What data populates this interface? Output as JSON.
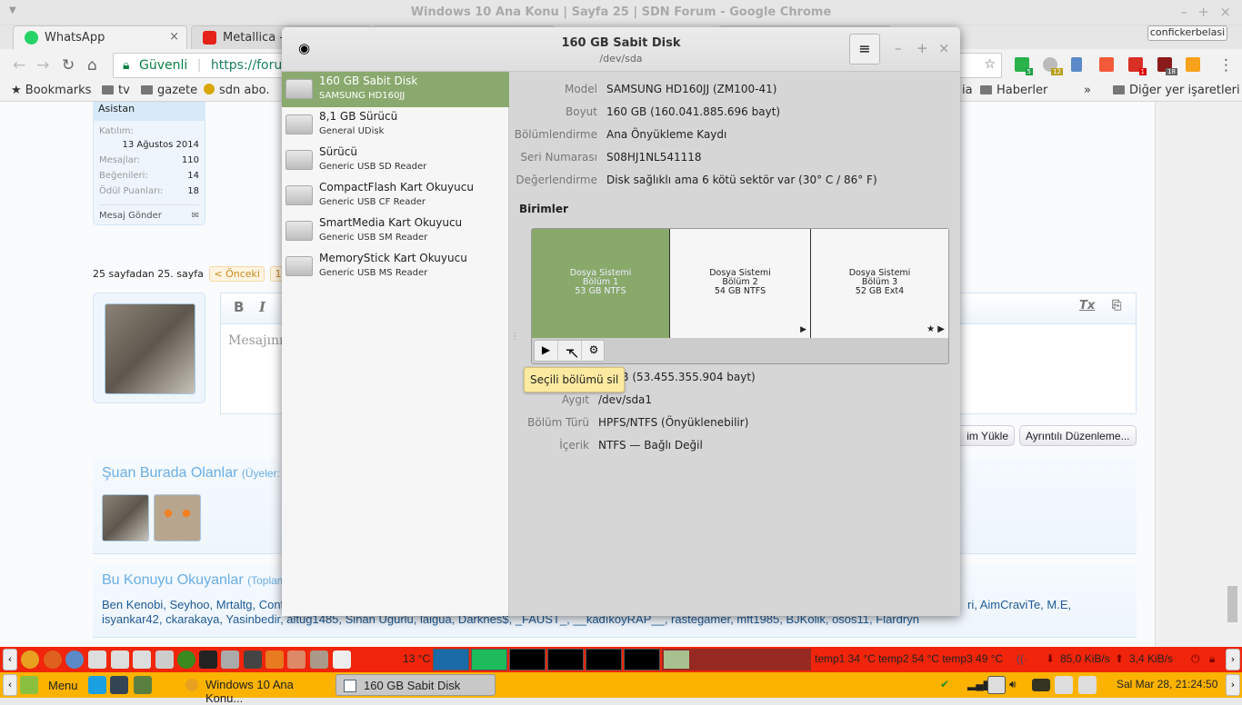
{
  "browser": {
    "window_title": "Windows 10 Ana Konu | Sayfa 25 | SDN Forum - Google Chrome",
    "tabs": [
      {
        "label": "WhatsApp",
        "close": "×"
      },
      {
        "label": "Metallica - Th"
      }
    ],
    "profile": "confickerbelasi",
    "security": "Güvenli",
    "url": "https://forum",
    "extension_badges": [
      "5",
      "12",
      "1",
      "18"
    ],
    "bookmarks": [
      "Bookmarks",
      "tv",
      "gazete",
      "sdn abo.",
      "ia",
      "Haberler",
      "»",
      "Diğer yer işaretleri"
    ]
  },
  "forum": {
    "user_title": "Asistan",
    "joined_label": "Katılım:",
    "joined": "13 Ağustos 2014",
    "stats": [
      {
        "label": "Mesajlar:",
        "value": "110"
      },
      {
        "label": "Beğenileri:",
        "value": "14"
      },
      {
        "label": "Ödül Puanları:",
        "value": "18"
      }
    ],
    "send_message": "Mesaj Gönder",
    "page_info": "25 sayfadan 25. sayfa",
    "prev": "< Önceki",
    "page1": "1",
    "arrow": "←",
    "editor": {
      "bold": "B",
      "italic": "I",
      "placeholder": "Mesajınız"
    },
    "buttons": {
      "upload": "im Yükle",
      "advanced": "Ayrıntılı Düzenleme..."
    },
    "here_title": "Şuan Burada Olanlar",
    "here_sub": "(Üyeler:",
    "readers_title": "Bu Konuyu Okuyanlar",
    "readers_sub": "(Toplam",
    "readers_line1": "Ben Kenobi, Seyhoo, Mrtaltg, Conf",
    "readers_line1_end": "ri, AimCraviTe, M.E,",
    "readers_line2": "isyankar42, ckarakaya, Yasinbedir, altug1485, Sinan Uğurlu, laigua, Darknes$, _FAUST_, __kadıköyRAP__, rastegamer, mft1985, BJKolik, osos11, Flardryn"
  },
  "disks": {
    "title": "160 GB Sabit Disk",
    "subtitle": "/dev/sda",
    "menu": "≡",
    "drives": [
      {
        "name": "160 GB Sabit Disk",
        "sub": "SAMSUNG HD160JJ"
      },
      {
        "name": "8,1 GB Sürücü",
        "sub": "General UDisk"
      },
      {
        "name": "Sürücü",
        "sub": "Generic USB SD Reader"
      },
      {
        "name": "CompactFlash Kart Okuyucu",
        "sub": "Generic USB CF Reader"
      },
      {
        "name": "SmartMedia Kart Okuyucu",
        "sub": "Generic USB SM Reader"
      },
      {
        "name": "MemoryStick Kart Okuyucu",
        "sub": "Generic USB MS Reader"
      }
    ],
    "info": [
      {
        "label": "Model",
        "value": "SAMSUNG HD160JJ (ZM100-41)"
      },
      {
        "label": "Boyut",
        "value": "160 GB (160.041.885.696 bayt)"
      },
      {
        "label": "Bölümlendirme",
        "value": "Ana Önyükleme Kaydı"
      },
      {
        "label": "Seri Numarası",
        "value": "S08HJ1NL541118"
      },
      {
        "label": "Değerlendirme",
        "value": "Disk sağlıklı ama 6 kötü sektör var (30° C / 86° F)"
      }
    ],
    "volumes_heading": "Birimler",
    "partitions": [
      {
        "l1": "Dosya Sistemi",
        "l2": "Bölüm 1",
        "l3": "53 GB NTFS"
      },
      {
        "l1": "Dosya Sistemi",
        "l2": "Bölüm 2",
        "l3": "54 GB NTFS"
      },
      {
        "l1": "Dosya Sistemi",
        "l2": "Bölüm 3",
        "l3": "52 GB Ext4"
      }
    ],
    "tooltip": "Seçili bölümü sil",
    "part_info": [
      {
        "label": "",
        "value": "GB (53.455.355.904 bayt)"
      },
      {
        "label": "Aygıt",
        "value": "/dev/sda1"
      },
      {
        "label": "Bölüm Türü",
        "value": "HPFS/NTFS (Önyüklenebilir)"
      },
      {
        "label": "İçerik",
        "value": "NTFS — Bağlı Değil"
      }
    ]
  },
  "panel": {
    "weather": "13 °C",
    "temps": "temp1 34 °C temp2 54 °C temp3 49 °C",
    "down": "85,0 KiB/s",
    "up": "3,4 KiB/s",
    "menu": "Menu",
    "tasks": [
      "Windows 10 Ana Konu...",
      "160 GB Sabit Disk"
    ],
    "clock": "Sal Mar 28, 21:24:50"
  }
}
